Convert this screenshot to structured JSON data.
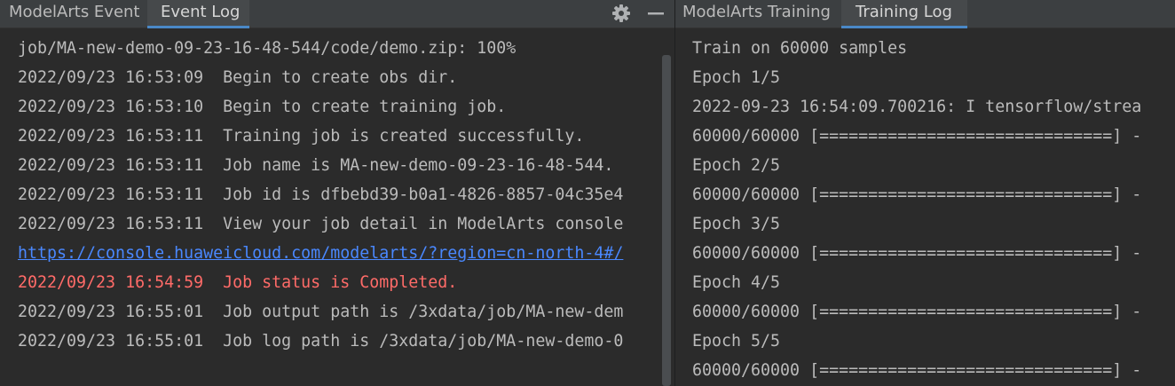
{
  "left": {
    "tabs": [
      {
        "label": "ModelArts Event",
        "active": false
      },
      {
        "label": "Event Log",
        "active": true
      }
    ],
    "toolbar": {
      "settings_icon": "gear-icon",
      "minimize_icon": "minimize-icon"
    },
    "lines": [
      {
        "text": "job/MA-new-demo-09-23-16-48-544/code/demo.zip: 100%",
        "kind": "normal"
      },
      {
        "text": "2022/09/23 16:53:09  Begin to create obs dir.",
        "kind": "normal"
      },
      {
        "text": "2022/09/23 16:53:10  Begin to create training job.",
        "kind": "normal"
      },
      {
        "text": "2022/09/23 16:53:11  Training job is created successfully.",
        "kind": "normal"
      },
      {
        "text": "2022/09/23 16:53:11  Job name is MA-new-demo-09-23-16-48-544.",
        "kind": "normal"
      },
      {
        "text": "2022/09/23 16:53:11  Job id is dfbebd39-b0a1-4826-8857-04c35e4",
        "kind": "normal"
      },
      {
        "text": "2022/09/23 16:53:11  View your job detail in ModelArts console",
        "kind": "normal"
      },
      {
        "text": "https://console.huaweicloud.com/modelarts/?region=cn-north-4#/",
        "kind": "link"
      },
      {
        "text": "2022/09/23 16:54:59  Job status is Completed.",
        "kind": "error"
      },
      {
        "text": "2022/09/23 16:55:01  Job output path is /3xdata/job/MA-new-dem",
        "kind": "normal"
      },
      {
        "text": "2022/09/23 16:55:01  Job log path is /3xdata/job/MA-new-demo-0",
        "kind": "normal"
      }
    ]
  },
  "right": {
    "tabs": [
      {
        "label": "ModelArts Training",
        "active": false
      },
      {
        "label": "Training Log",
        "active": true
      }
    ],
    "lines": [
      {
        "text": "Train on 60000 samples",
        "kind": "normal"
      },
      {
        "text": "Epoch 1/5",
        "kind": "normal"
      },
      {
        "text": "2022-09-23 16:54:09.700216: I tensorflow/strea",
        "kind": "normal"
      },
      {
        "text": "60000/60000 [==============================] -",
        "kind": "normal"
      },
      {
        "text": "Epoch 2/5",
        "kind": "normal"
      },
      {
        "text": "60000/60000 [==============================] -",
        "kind": "normal"
      },
      {
        "text": "Epoch 3/5",
        "kind": "normal"
      },
      {
        "text": "60000/60000 [==============================] -",
        "kind": "normal"
      },
      {
        "text": "Epoch 4/5",
        "kind": "normal"
      },
      {
        "text": "60000/60000 [==============================] -",
        "kind": "normal"
      },
      {
        "text": "Epoch 5/5",
        "kind": "normal"
      },
      {
        "text": "60000/60000 [==============================] -",
        "kind": "normal"
      }
    ]
  },
  "colors": {
    "background": "#2b2b2b",
    "tab_bar": "#3c3f41",
    "text": "#bbbbbb",
    "link": "#4a88ff",
    "error": "#ff6b68",
    "accent": "#4a88c7"
  }
}
